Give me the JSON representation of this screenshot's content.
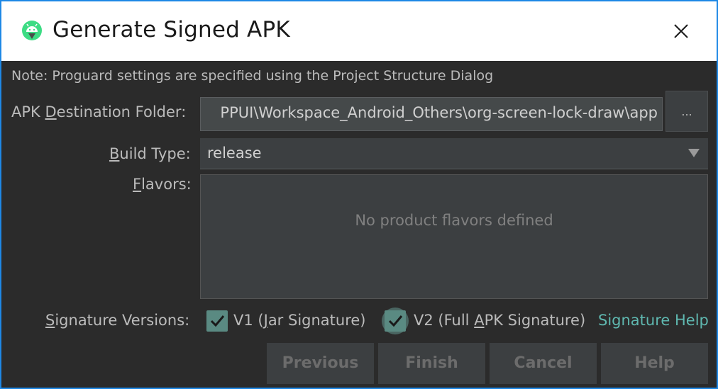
{
  "window": {
    "title": "Generate Signed APK",
    "accent_color": "#1e88e5",
    "app_icon": "android-studio-icon",
    "close_icon": "close-icon"
  },
  "note": "Note: Proguard settings are specified using the Project Structure Dialog",
  "destination": {
    "label_pre": "APK ",
    "label_mnemonic": "D",
    "label_post": "estination Folder:",
    "value": "PPUI\\Workspace_Android_Others\\org-screen-lock-draw\\app",
    "browse_label": "..."
  },
  "build_type": {
    "label_mnemonic": "B",
    "label_post": "uild Type:",
    "value": "release",
    "dropdown_icon": "chevron-down-icon"
  },
  "flavors": {
    "label_mnemonic": "F",
    "label_post": "lavors:",
    "empty_text": "No product flavors defined"
  },
  "signature": {
    "label_mnemonic": "S",
    "label_post": "ignature Versions:",
    "v1": {
      "checked": true,
      "pre": "V1 (",
      "mnemonic": "J",
      "post": "ar Signature)"
    },
    "v2": {
      "checked": true,
      "pre": "V2 (Full ",
      "mnemonic": "A",
      "post": "PK Signature)"
    },
    "help_link": "Signature Help",
    "checkbox_color": "#5a8a82",
    "link_color": "#5fb8b0"
  },
  "buttons": {
    "previous": "Previous",
    "finish": "Finish",
    "cancel": "Cancel",
    "help": "Help"
  }
}
